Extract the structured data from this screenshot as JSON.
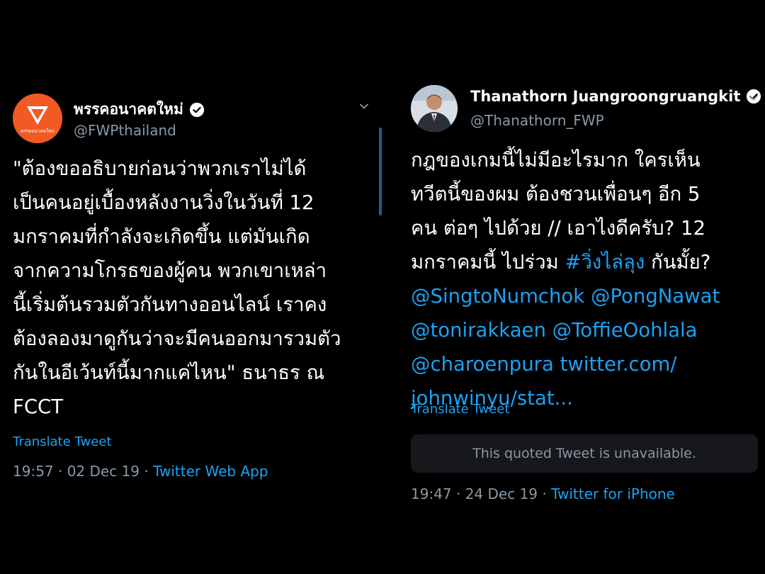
{
  "left_tweet": {
    "display_name": "พรรคอนาคตใหม่",
    "handle": "@FWPthailand",
    "avatar_caption": "พรรคอนาคตใหม่",
    "body_lines": [
      "\"ต้องขออธิบายก่อนว่าพวกเราไม่ได้",
      "เป็นคนอยู่เบื้องหลังงานวิ่งในวันที่ 12",
      "มกราคมที่กำลังจะเกิดขึ้น แต่มันเกิด",
      "จากความโกรธของผู้คน พวกเขาเหล่า",
      "นี้เริ่มต้นรวมตัวกันทางออนไลน์ เราคง",
      "ต้องลองมาดูกันว่าจะมีคนออกมารวมตัว",
      "กันในอีเว้นท์นี้มากแค่ไหน\" ธนาธร ณ",
      "FCCT"
    ],
    "translate": "Translate Tweet",
    "timestamp": "19:57 · 02 Dec 19 · ",
    "app": "Twitter Web App"
  },
  "right_tweet": {
    "display_name": "Thanathorn Juangroongruangkit",
    "handle": "@Thanathorn_FWP",
    "body": {
      "l1": "กฎของเกมนี้ไม่มีอะไรมาก ใครเห็น",
      "l2": "ทวีตนี้ของผม ต้องชวนเพื่อนๆ อีก 5",
      "l3": "คน ต่อๆ ไปด้วย  // เอาไงดีครับ? 12",
      "l4a": "มกราคมนี้ ไปร่วม ",
      "hashtag": "#วิ่งไล่ลุง",
      "l4b": " กันมั้ย?",
      "m1": "@SingtoNumchok",
      "m2": "@PongNawat",
      "m3": "@tonirakkaen",
      "m4": "@ToffieOohlala",
      "m5": "@charoenpura",
      "url1": "twitter.com/",
      "url2": "johnwinyu/stat..."
    },
    "translate": "Translate Tweet",
    "quoted_unavailable": "This quoted Tweet is unavailable.",
    "timestamp": "19:47 · 24 Dec 19 · ",
    "app": "Twitter for iPhone"
  },
  "icons": {
    "verified": "verified-badge-icon",
    "chevron": "chevron-down-icon",
    "logo": "future-forward-party-logo-icon"
  },
  "colors": {
    "background": "#000000",
    "link": "#1da1f2",
    "secondary_text": "#8899a6",
    "brand_orange": "#f15a22"
  }
}
